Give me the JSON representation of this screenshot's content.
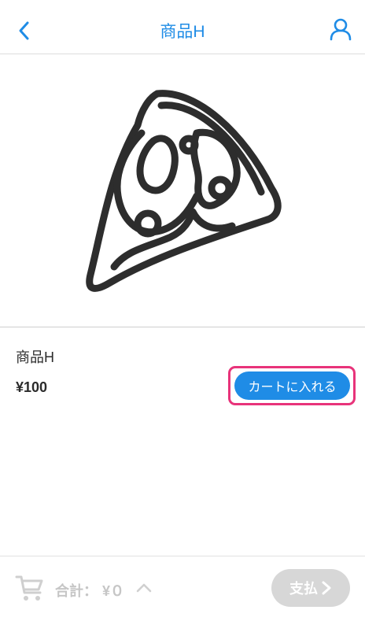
{
  "header": {
    "title": "商品H",
    "back_icon": "chevron-left-icon",
    "user_icon": "user-icon",
    "accent_color": "#1f8ce6"
  },
  "product": {
    "image_icon": "pizza-slice-icon",
    "name": "商品H",
    "price": "¥100",
    "add_to_cart_label": "カートに入れる"
  },
  "footer": {
    "cart_icon": "cart-icon",
    "total_label": "合計：",
    "total_value": "¥０",
    "expand_icon": "chevron-up-icon",
    "pay_label": "支払",
    "pay_icon": "chevron-right-icon",
    "pay_enabled": false
  },
  "colors": {
    "primary": "#1f8ce6",
    "highlight": "#e8337a",
    "disabled": "#d7d7d7"
  }
}
